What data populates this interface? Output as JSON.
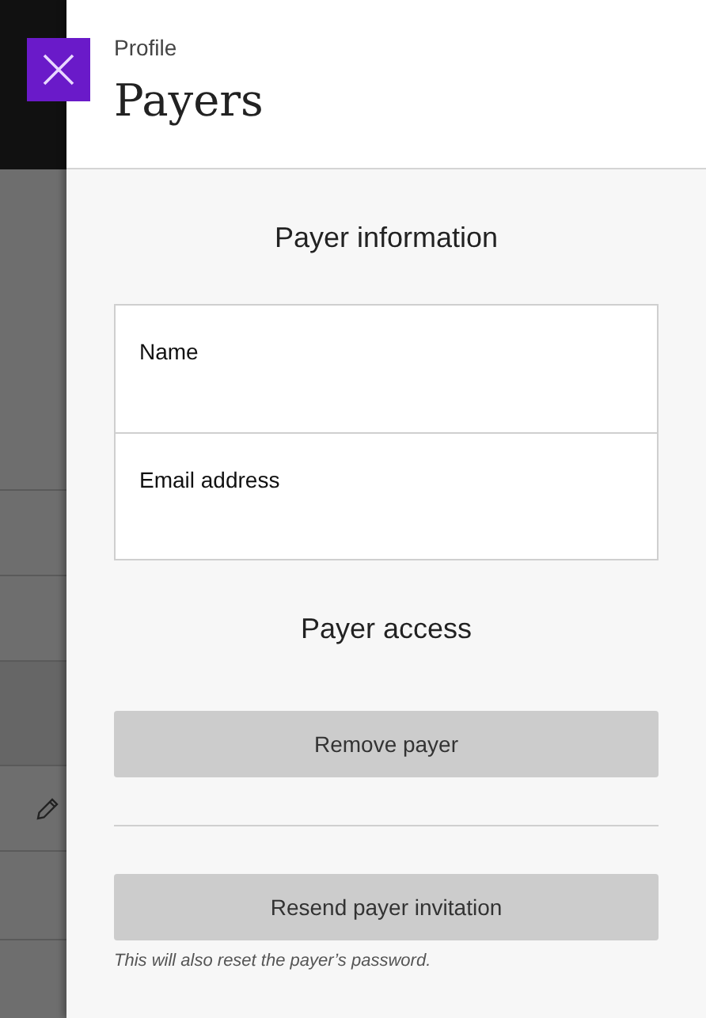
{
  "header": {
    "subtitle": "Profile",
    "title": "Payers"
  },
  "payer_information": {
    "heading": "Payer information",
    "fields": [
      {
        "label": "Name"
      },
      {
        "label": "Email address"
      }
    ]
  },
  "payer_access": {
    "heading": "Payer access",
    "buttons": [
      {
        "label": "Remove payer"
      },
      {
        "label": "Resend payer invitation"
      }
    ],
    "note": "This will also reset the payer’s password."
  }
}
